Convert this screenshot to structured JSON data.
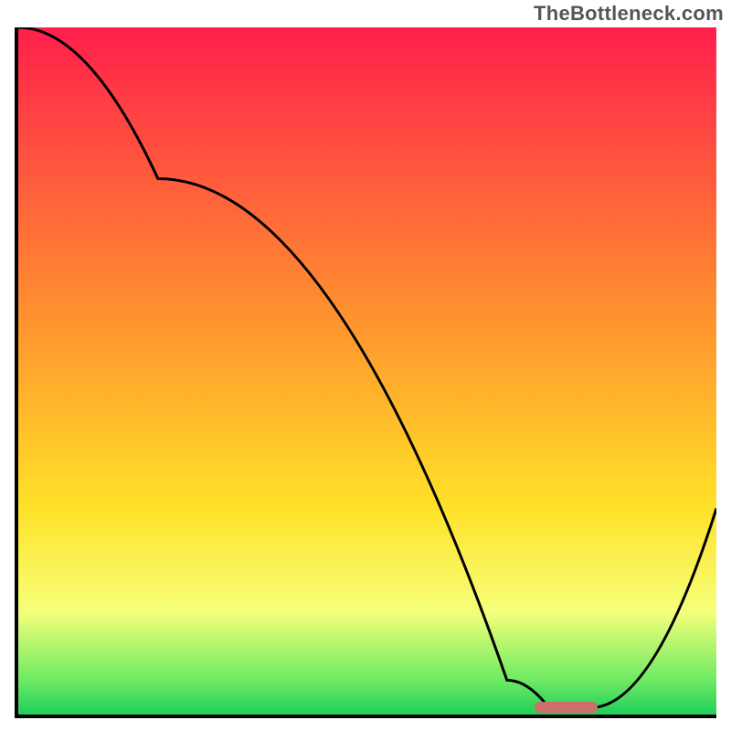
{
  "watermark": "TheBottleneck.com",
  "chart_data": {
    "type": "line",
    "title": "",
    "xlabel": "",
    "ylabel": "",
    "xlim": [
      0,
      100
    ],
    "ylim": [
      0,
      100
    ],
    "x": [
      0,
      20,
      70,
      76,
      82,
      100
    ],
    "values": [
      100,
      78,
      5,
      1,
      1,
      30
    ],
    "notes": "Bottleneck curve; valley (optimum) near x≈76–82 where value≈1.",
    "gradient_stops": [
      {
        "pct": 0,
        "color": "#ff1f4b"
      },
      {
        "pct": 45,
        "color": "#ff9a2e"
      },
      {
        "pct": 70,
        "color": "#ffe228"
      },
      {
        "pct": 85,
        "color": "#f6ff7a"
      },
      {
        "pct": 95,
        "color": "#6eea63"
      },
      {
        "pct": 100,
        "color": "#1fcf5b"
      }
    ],
    "optimum_marker": {
      "x_start": 74,
      "x_end": 83,
      "y": 1
    }
  },
  "colors": {
    "axis": "#000000",
    "curve": "#000000",
    "marker": "#ce6d6b",
    "watermark": "#555555"
  }
}
